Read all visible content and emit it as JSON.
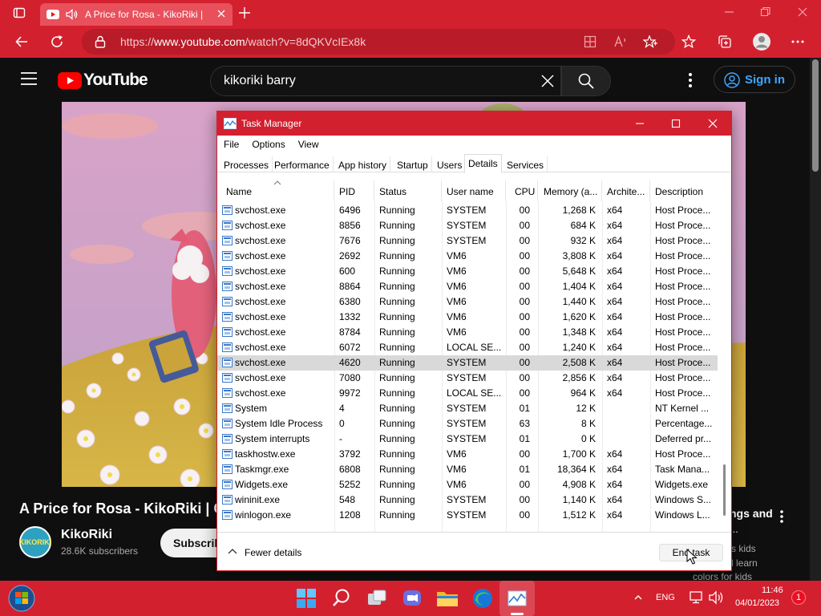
{
  "browser": {
    "tab_title": "A Price for Rosa - KikoRiki |",
    "url_prefix": "https://",
    "url_domain": "www.youtube.com",
    "url_path": "/watch?v=8dQKVcIEx8k"
  },
  "youtube": {
    "logo": "YouTube",
    "search_value": "kikoriki barry",
    "signin_label": "Sign in",
    "video_title": "A Price for Rosa - KikoRiki | C",
    "channel_name": "KikoRiki",
    "channel_subs": "28.6K subscribers",
    "subscribe_label": "Subscrib",
    "side_title": "ngs and",
    "side_dots": "...",
    "side_line1": "s kids",
    "side_line2": "l learn",
    "side_line3": "colors for kids",
    "avatar_text": "KIKORIKI"
  },
  "task_manager": {
    "title": "Task Manager",
    "menu": [
      "File",
      "Options",
      "View"
    ],
    "tabs": [
      "Processes",
      "Performance",
      "App history",
      "Startup",
      "Users",
      "Details",
      "Services"
    ],
    "active_tab": "Details",
    "columns": [
      "Name",
      "PID",
      "Status",
      "User name",
      "CPU",
      "Memory (a...",
      "Archite...",
      "Description"
    ],
    "selected_row": 10,
    "rows": [
      [
        "svchost.exe",
        "6496",
        "Running",
        "SYSTEM",
        "00",
        "1,268 K",
        "x64",
        "Host Proce..."
      ],
      [
        "svchost.exe",
        "8856",
        "Running",
        "SYSTEM",
        "00",
        "684 K",
        "x64",
        "Host Proce..."
      ],
      [
        "svchost.exe",
        "7676",
        "Running",
        "SYSTEM",
        "00",
        "932 K",
        "x64",
        "Host Proce..."
      ],
      [
        "svchost.exe",
        "2692",
        "Running",
        "VM6",
        "00",
        "3,808 K",
        "x64",
        "Host Proce..."
      ],
      [
        "svchost.exe",
        "600",
        "Running",
        "VM6",
        "00",
        "5,648 K",
        "x64",
        "Host Proce..."
      ],
      [
        "svchost.exe",
        "8864",
        "Running",
        "VM6",
        "00",
        "1,404 K",
        "x64",
        "Host Proce..."
      ],
      [
        "svchost.exe",
        "6380",
        "Running",
        "VM6",
        "00",
        "1,440 K",
        "x64",
        "Host Proce..."
      ],
      [
        "svchost.exe",
        "1332",
        "Running",
        "VM6",
        "00",
        "1,620 K",
        "x64",
        "Host Proce..."
      ],
      [
        "svchost.exe",
        "8784",
        "Running",
        "VM6",
        "00",
        "1,348 K",
        "x64",
        "Host Proce..."
      ],
      [
        "svchost.exe",
        "6072",
        "Running",
        "LOCAL SE...",
        "00",
        "1,240 K",
        "x64",
        "Host Proce..."
      ],
      [
        "svchost.exe",
        "4620",
        "Running",
        "SYSTEM",
        "00",
        "2,508 K",
        "x64",
        "Host Proce..."
      ],
      [
        "svchost.exe",
        "7080",
        "Running",
        "SYSTEM",
        "00",
        "2,856 K",
        "x64",
        "Host Proce..."
      ],
      [
        "svchost.exe",
        "9972",
        "Running",
        "LOCAL SE...",
        "00",
        "964 K",
        "x64",
        "Host Proce..."
      ],
      [
        "System",
        "4",
        "Running",
        "SYSTEM",
        "01",
        "12 K",
        "",
        "NT Kernel ..."
      ],
      [
        "System Idle Process",
        "0",
        "Running",
        "SYSTEM",
        "63",
        "8 K",
        "",
        "Percentage..."
      ],
      [
        "System interrupts",
        "-",
        "Running",
        "SYSTEM",
        "01",
        "0 K",
        "",
        "Deferred pr..."
      ],
      [
        "taskhostw.exe",
        "3792",
        "Running",
        "VM6",
        "00",
        "1,700 K",
        "x64",
        "Host Proce..."
      ],
      [
        "Taskmgr.exe",
        "6808",
        "Running",
        "VM6",
        "01",
        "18,364 K",
        "x64",
        "Task Mana..."
      ],
      [
        "Widgets.exe",
        "5252",
        "Running",
        "VM6",
        "00",
        "4,908 K",
        "x64",
        "Widgets.exe"
      ],
      [
        "wininit.exe",
        "548",
        "Running",
        "SYSTEM",
        "00",
        "1,140 K",
        "x64",
        "Windows S..."
      ],
      [
        "winlogon.exe",
        "1208",
        "Running",
        "SYSTEM",
        "00",
        "1,512 K",
        "x64",
        "Windows L..."
      ]
    ],
    "fewer_details": "Fewer details",
    "end_task": "End task"
  },
  "taskbar": {
    "lang": "ENG",
    "time": "11:46",
    "date": "04/01/2023",
    "notification_count": "1"
  },
  "colors": {
    "accent_red": "#d3202f",
    "youtube_red": "#ff0000",
    "signin_blue": "#3ea6ff"
  }
}
